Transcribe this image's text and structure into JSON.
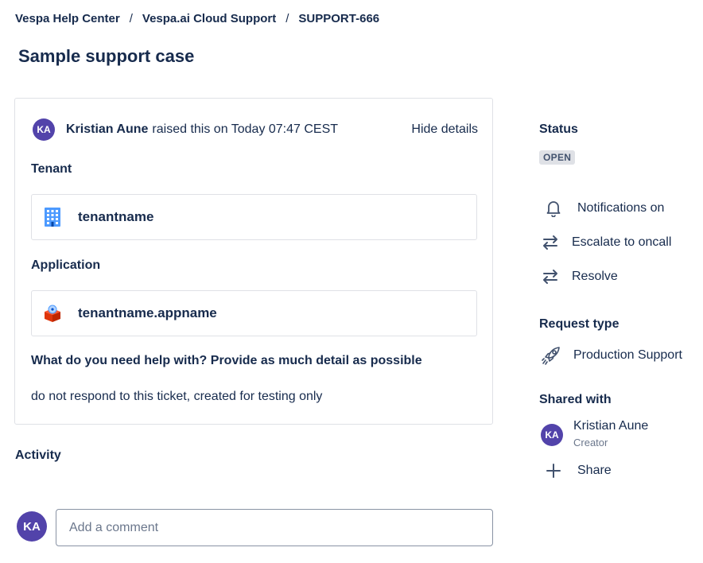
{
  "breadcrumb": [
    "Vespa Help Center",
    "Vespa.ai Cloud Support",
    "SUPPORT-666"
  ],
  "breadcrumb_separator": "/",
  "title": "Sample support case",
  "request": {
    "reporter_initials": "KA",
    "reporter_name": "Kristian Aune",
    "raised_text": "raised this on Today 07:47 CEST",
    "hide_details": "Hide details",
    "fields": [
      {
        "label": "Tenant",
        "value": "tenantname",
        "icon": "building-icon"
      },
      {
        "label": "Application",
        "value": "tenantname.appname",
        "icon": "application-icon"
      }
    ],
    "question": "What do you need help with? Provide as much detail as possible",
    "answer": "do not respond to this ticket, created for testing only"
  },
  "activity": {
    "label": "Activity",
    "avatar_initials": "KA",
    "comment_placeholder": "Add a comment"
  },
  "sidebar": {
    "status_label": "Status",
    "status_value": "OPEN",
    "actions": [
      {
        "label": "Notifications on",
        "icon": "bell-icon"
      },
      {
        "label": "Escalate to oncall",
        "icon": "transition-arrows-icon"
      },
      {
        "label": "Resolve",
        "icon": "transition-arrows-icon"
      }
    ],
    "request_type_label": "Request type",
    "request_type_value": "Production Support",
    "request_type_icon": "rocket-icon",
    "shared_with_label": "Shared with",
    "shared_users": [
      {
        "initials": "KA",
        "name": "Kristian Aune",
        "role": "Creator"
      }
    ],
    "share_label": "Share"
  },
  "colors": {
    "avatar": "#5243aa",
    "text": "#172b4d",
    "border": "#dfe1e6",
    "lozenge_bg": "#dfe1e6"
  }
}
